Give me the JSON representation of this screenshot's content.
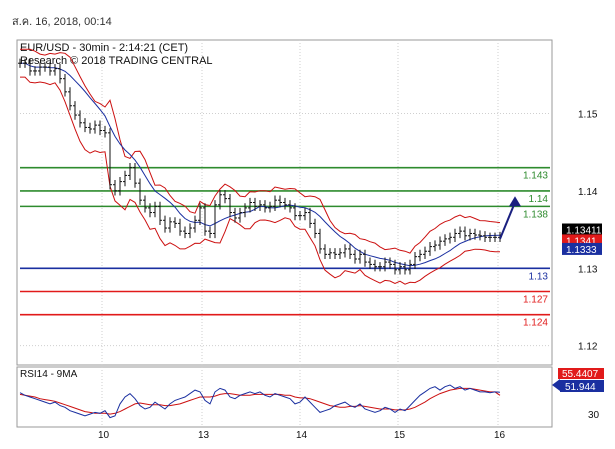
{
  "header": {
    "timestamp": "ส.ค. 16, 2018, 00:14"
  },
  "chart_data": {
    "type": "line",
    "title": "EUR/USD - 30min - 2:14:21 (CET)",
    "subtitle": "Research © 2018 TRADING CENTRAL",
    "x_tick_labels": [
      "10",
      "13",
      "14",
      "15",
      "16"
    ],
    "y_tick_labels": [
      "1.15",
      "1.14",
      "1.13",
      "1.12"
    ],
    "ylim": [
      1.1175,
      1.1595
    ],
    "grid": true,
    "price": {
      "name": "EUR/USD",
      "x": [
        0,
        5,
        10,
        15,
        20,
        25,
        30,
        35,
        40,
        45,
        50,
        55,
        60,
        65,
        70,
        75,
        80,
        85,
        90,
        95,
        100,
        105,
        110,
        115,
        120,
        125,
        130,
        135,
        140,
        145,
        150,
        155,
        160,
        165,
        170,
        175,
        180,
        185,
        190,
        195,
        200,
        205,
        210,
        215,
        220,
        225,
        230,
        235,
        240,
        245,
        250,
        255,
        260,
        265,
        270,
        275,
        280,
        285,
        290,
        295,
        300,
        305,
        310,
        315,
        320,
        325,
        330,
        335,
        340,
        345,
        350,
        355,
        360,
        365,
        370,
        375,
        380,
        385,
        390,
        395,
        400,
        405,
        410,
        415,
        420,
        425,
        430,
        435,
        440,
        445,
        450,
        455,
        460,
        465,
        470,
        475,
        480
      ],
      "values": [
        1.1565,
        1.1565,
        1.1555,
        1.1555,
        1.156,
        1.156,
        1.1555,
        1.1558,
        1.1545,
        1.1528,
        1.151,
        1.1498,
        1.1488,
        1.1482,
        1.148,
        1.1485,
        1.1478,
        1.1475,
        1.1408,
        1.14,
        1.1412,
        1.142,
        1.143,
        1.141,
        1.1388,
        1.1378,
        1.1372,
        1.138,
        1.1362,
        1.1352,
        1.136,
        1.1358,
        1.1348,
        1.1345,
        1.1352,
        1.1362,
        1.1378,
        1.1348,
        1.1345,
        1.1382,
        1.1395,
        1.139,
        1.1372,
        1.1365,
        1.1372,
        1.1378,
        1.1385,
        1.138,
        1.1382,
        1.1378,
        1.138,
        1.1388,
        1.1385,
        1.1382,
        1.1378,
        1.1368,
        1.1368,
        1.1372,
        1.1358,
        1.1345,
        1.1325,
        1.1318,
        1.132,
        1.1318,
        1.132,
        1.1325,
        1.1318,
        1.1312,
        1.1318,
        1.1308,
        1.1305,
        1.1302,
        1.1302,
        1.1308,
        1.1305,
        1.1298,
        1.1302,
        1.1298,
        1.1305,
        1.1315,
        1.1318,
        1.1322,
        1.1328,
        1.133,
        1.1335,
        1.1338,
        1.134,
        1.1345,
        1.1348,
        1.1342,
        1.1345,
        1.1343,
        1.1342,
        1.134,
        1.134,
        1.134,
        1.1341
      ]
    },
    "levels": [
      {
        "value": 1.143,
        "label": "1.143",
        "color": "#2e8b2e"
      },
      {
        "value": 1.14,
        "label": "1.14",
        "color": "#2e8b2e"
      },
      {
        "value": 1.138,
        "label": "1.138",
        "color": "#2e8b2e"
      },
      {
        "value": 1.13,
        "label": "1.13",
        "color": "#1a2fa0"
      },
      {
        "value": 1.127,
        "label": "1.127",
        "color": "#e11a1a"
      },
      {
        "value": 1.124,
        "label": "1.124",
        "color": "#e11a1a"
      }
    ],
    "current_price": {
      "value": 1.13411,
      "label": "1.13411"
    },
    "ma_red_marker": {
      "value": 1.1341,
      "label": "1.1341",
      "color": "#e11a1a"
    },
    "ma_blue_marker": {
      "value": 1.1333,
      "label": "1.1333",
      "color": "#1a2fa0"
    },
    "arrow": {
      "from": [
        480,
        1.1338
      ],
      "to": [
        495,
        1.1393
      ],
      "color": "#1a2080"
    },
    "rsi": {
      "title": "RSI14 - 9MA",
      "ylim": [
        15,
        85
      ],
      "y_tick_labels": [
        "30"
      ],
      "markers": [
        {
          "label": "55.4407",
          "value": 55.4407,
          "color": "#e11a1a"
        },
        {
          "label": "51.944",
          "value": 51.944,
          "color": "#1a2fa0"
        }
      ],
      "rsi_values": [
        55,
        52,
        50,
        48,
        46,
        44,
        42,
        44,
        40,
        38,
        34,
        32,
        30,
        28,
        30,
        32,
        31,
        34,
        26,
        28,
        42,
        50,
        54,
        48,
        40,
        36,
        38,
        44,
        40,
        36,
        42,
        46,
        48,
        50,
        54,
        58,
        56,
        46,
        42,
        56,
        60,
        58,
        50,
        48,
        52,
        54,
        56,
        54,
        56,
        52,
        50,
        54,
        52,
        50,
        48,
        42,
        44,
        50,
        44,
        38,
        32,
        34,
        36,
        40,
        42,
        44,
        40,
        38,
        42,
        36,
        34,
        32,
        34,
        38,
        36,
        32,
        36,
        34,
        40,
        46,
        52,
        56,
        60,
        62,
        58,
        62,
        64,
        60,
        62,
        58,
        60,
        58,
        56,
        56,
        55,
        56,
        55.44
      ],
      "ma_values": [
        53,
        52,
        51,
        50,
        48,
        47,
        46,
        45,
        43,
        41,
        39,
        37,
        35,
        33,
        32,
        31,
        31,
        31,
        30,
        31,
        33,
        36,
        39,
        42,
        43,
        42,
        41,
        41,
        41,
        40,
        40,
        41,
        42,
        44,
        46,
        48,
        50,
        50,
        50,
        51,
        53,
        54,
        54,
        53,
        52,
        52,
        52,
        53,
        53,
        53,
        53,
        53,
        53,
        52,
        52,
        50,
        49,
        49,
        48,
        46,
        44,
        42,
        40,
        39,
        38,
        38,
        39,
        39,
        40,
        39,
        38,
        37,
        36,
        36,
        36,
        35,
        35,
        35,
        36,
        38,
        41,
        44,
        48,
        51,
        54,
        56,
        58,
        59,
        60,
        60,
        60,
        59,
        58,
        57,
        56,
        56,
        51.944
      ]
    }
  }
}
